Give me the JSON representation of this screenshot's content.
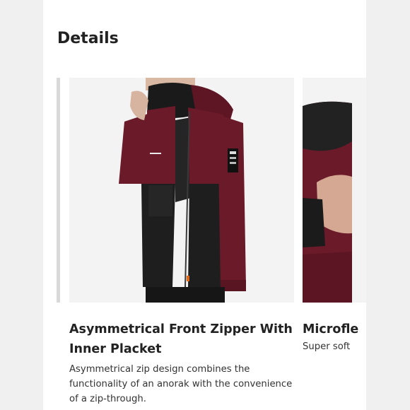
{
  "section": {
    "heading": "Details"
  },
  "cards": [
    {
      "title": "Asymmetrical Front Zipper With Inner Placket",
      "description": "Asymmetrical zip design combines the functionality of an anorak with the convenience of a zip-through.",
      "image_label": "jacket-front-photo"
    },
    {
      "title": "Microfle",
      "description": "Super soft",
      "image_label": "jacket-collar-photo"
    }
  ],
  "colors": {
    "burgundy": "#6b1a2a",
    "black": "#1e1e1e",
    "background": "#f0f0f0"
  }
}
